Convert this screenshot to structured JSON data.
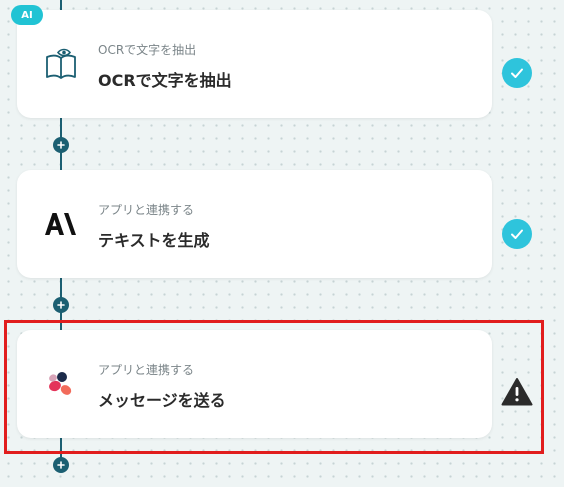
{
  "flow": {
    "steps": [
      {
        "badge": "AI",
        "subtitle": "OCRで文字を抽出",
        "title": "OCRで文字を抽出",
        "icon": "ocr-book-eye-icon",
        "status": "complete"
      },
      {
        "subtitle": "アプリと連携する",
        "title": "テキストを生成",
        "icon": "anthropic-logo-icon",
        "status": "complete"
      },
      {
        "subtitle": "アプリと連携する",
        "title": "メッセージを送る",
        "icon": "chatwork-logo-icon",
        "status": "warning"
      }
    ],
    "highlighted_step": 3
  },
  "colors": {
    "background": "#eef4f4",
    "connector": "#1b5f72",
    "accent": "#21c3d4",
    "check": "#2ec4dc",
    "highlight": "#e11d1d",
    "warning": "#2b2b2b"
  }
}
